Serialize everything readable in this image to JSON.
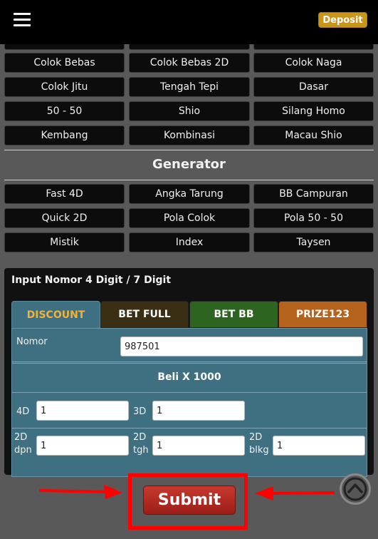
{
  "header": {
    "deposit_label": "Deposit"
  },
  "menu": {
    "rows": [
      [
        "Colok Bebas",
        "Colok Bebas 2D",
        "Colok Naga"
      ],
      [
        "Colok Jitu",
        "Tengah Tepi",
        "Dasar"
      ],
      [
        "50 - 50",
        "Shio",
        "Silang Homo"
      ],
      [
        "Kembang",
        "Kombinasi",
        "Macau Shio"
      ]
    ]
  },
  "generator": {
    "title": "Generator",
    "rows": [
      [
        "Fast 4D",
        "Angka Tarung",
        "BB Campuran"
      ],
      [
        "Quick 2D",
        "Pola Colok",
        "Pola 50 - 50"
      ],
      [
        "Mistik",
        "Index",
        "Taysen"
      ]
    ]
  },
  "form": {
    "title": "Input Nomor 4 Digit / 7 Digit",
    "tabs": [
      "DISCOUNT",
      "BET FULL",
      "BET BB",
      "PRIZE123"
    ],
    "active_tab": "DISCOUNT",
    "nomor_label": "Nomor",
    "nomor_value": "987501",
    "beli_label": "Beli X 1000",
    "fields": {
      "4d": {
        "label": "4D",
        "value": "1"
      },
      "3d": {
        "label": "3D",
        "value": "1"
      },
      "2d_dpn": {
        "label1": "2D",
        "label2": "dpn",
        "value": "1"
      },
      "2d_tgh": {
        "label1": "2D",
        "label2": "tgh",
        "value": "1"
      },
      "2d_blkg": {
        "label1": "2D",
        "label2": "blkg",
        "value": "1"
      }
    }
  },
  "submit_label": "Submit",
  "colors": {
    "deposit": "#c9961a",
    "tab_active_text": "#f3b236",
    "form_bg": "#3f7082",
    "submit": "#b52a22",
    "annotation": "#ff0000"
  },
  "icons": [
    "hamburger-menu-icon",
    "scroll-to-top-icon",
    "arrow-right-icon",
    "arrow-left-icon"
  ]
}
